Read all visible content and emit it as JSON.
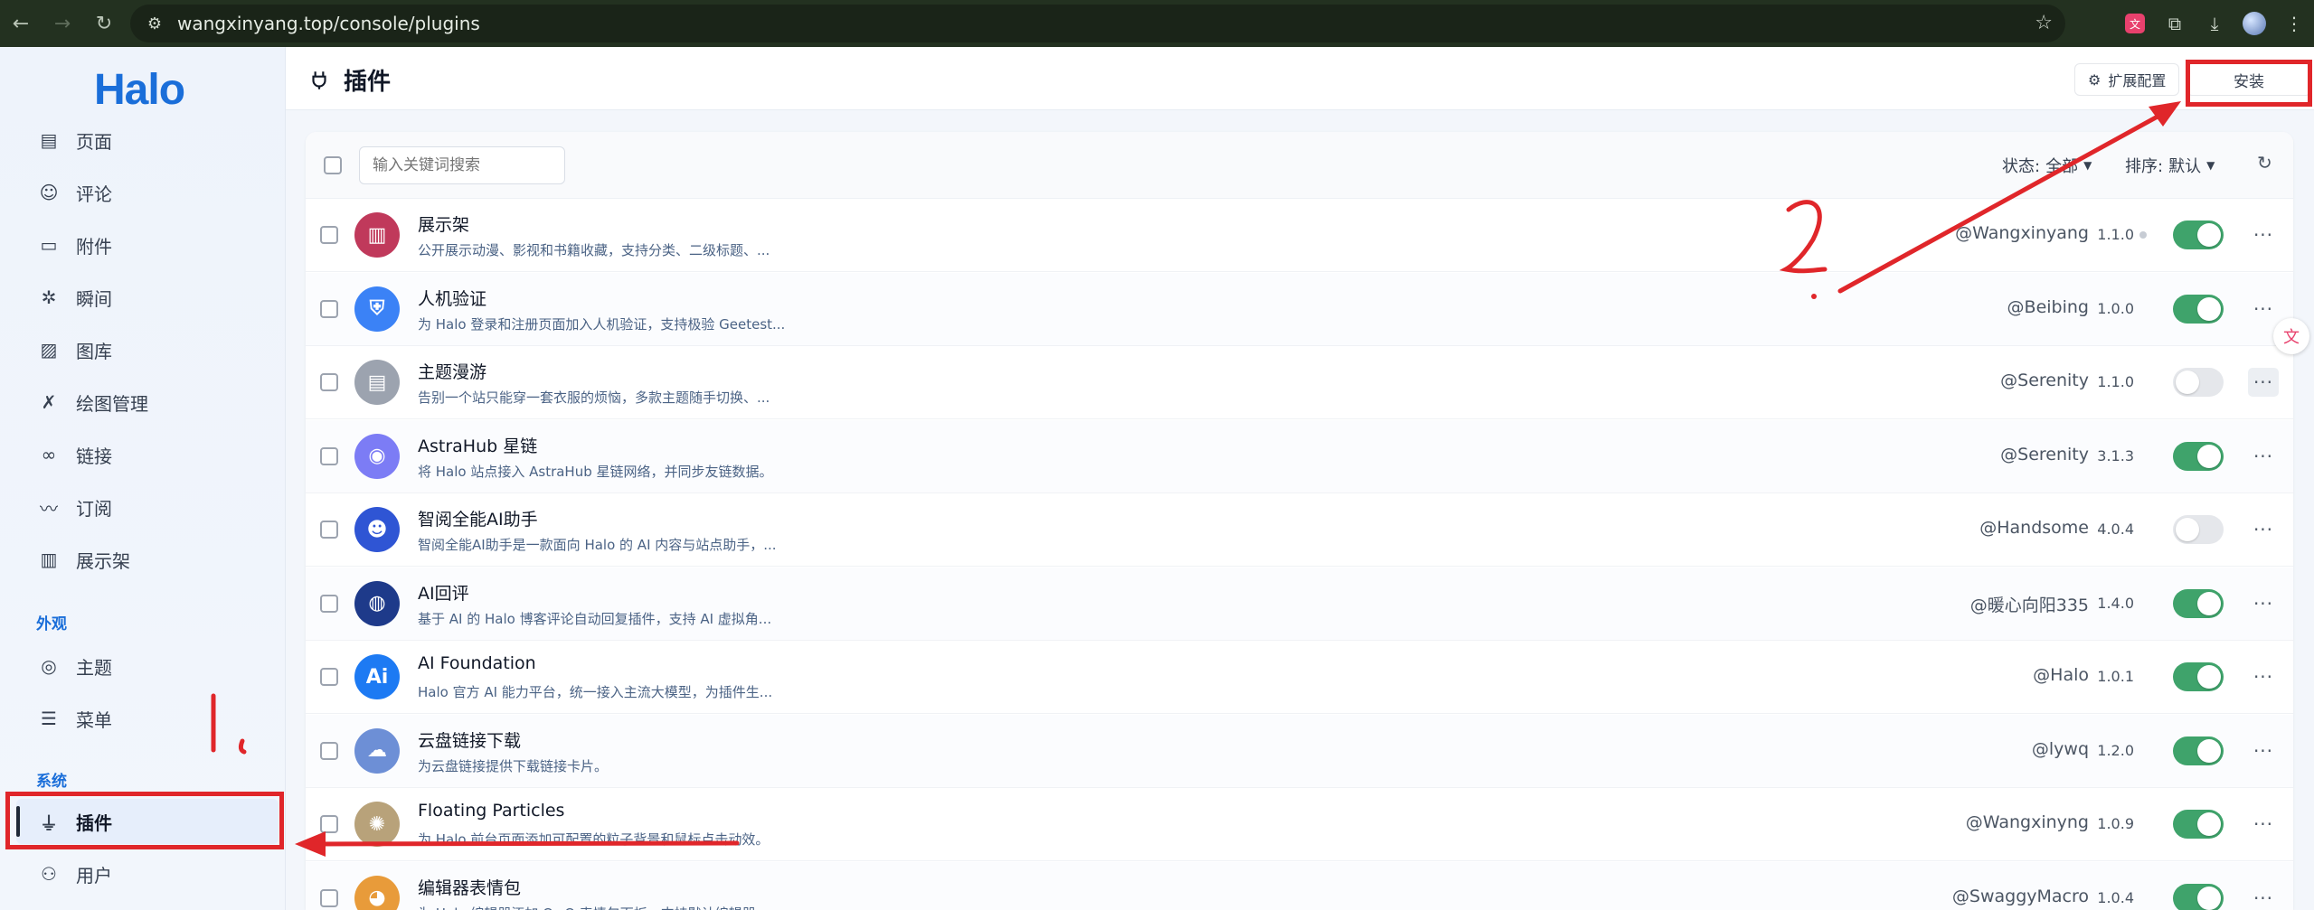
{
  "browser": {
    "url": "wangxinyang.top/console/plugins"
  },
  "sidebar": {
    "logo": "Halo",
    "items": [
      {
        "key": "page",
        "label": "页面",
        "icon": "document-icon"
      },
      {
        "key": "comment",
        "label": "评论",
        "icon": "comment-icon"
      },
      {
        "key": "attachment",
        "label": "附件",
        "icon": "folder-icon"
      },
      {
        "key": "moment",
        "label": "瞬间",
        "icon": "aperture-icon"
      },
      {
        "key": "gallery",
        "label": "图库",
        "icon": "image-icon"
      },
      {
        "key": "drawing",
        "label": "绘图管理",
        "icon": "tools-icon"
      },
      {
        "key": "links",
        "label": "链接",
        "icon": "link-icon"
      },
      {
        "key": "subscribe",
        "label": "订阅",
        "icon": "rss-icon"
      },
      {
        "key": "shelf",
        "label": "展示架",
        "icon": "shelf-icon"
      }
    ],
    "group_appearance": "外观",
    "appearance_items": [
      {
        "key": "theme",
        "label": "主题",
        "icon": "palette-icon"
      },
      {
        "key": "menu",
        "label": "菜单",
        "icon": "menu-settings-icon"
      }
    ],
    "group_system": "系统",
    "system_items": [
      {
        "key": "plugins",
        "label": "插件",
        "icon": "plug-icon",
        "active": true
      },
      {
        "key": "users",
        "label": "用户",
        "icon": "user-icon"
      }
    ]
  },
  "header": {
    "title": "插件",
    "ext_config_label": "扩展配置",
    "install_label": "安装"
  },
  "toolbar": {
    "search_placeholder": "输入关键词搜索",
    "status_label": "状态:",
    "status_value": "全部",
    "sort_label": "排序:",
    "sort_value": "默认"
  },
  "plugins": [
    {
      "name": "展示架",
      "desc": "公开展示动漫、影视和书籍收藏，支持分类、二级标题、...",
      "author": "@Wangxinyang",
      "version": "1.1.0",
      "enabled": true,
      "logo_color": "#c0395b",
      "logo_text": "▥",
      "dot": true
    },
    {
      "name": "人机验证",
      "desc": "为 Halo 登录和注册页面加入人机验证，支持极验 Geetest...",
      "author": "@Beibing",
      "version": "1.0.0",
      "enabled": true,
      "logo_color": "#3b82f6",
      "logo_text": "⛨"
    },
    {
      "name": "主题漫游",
      "desc": "告别一个站只能穿一套衣服的烦恼，多款主题随手切换、...",
      "author": "@Serenity",
      "version": "1.1.0",
      "enabled": false,
      "logo_color": "#9ca3af",
      "logo_text": "▤",
      "more_hover": true
    },
    {
      "name": "AstraHub 星链",
      "desc": "将 Halo 站点接入 AstraHub 星链网络，并同步友链数据。",
      "author": "@Serenity",
      "version": "3.1.3",
      "enabled": true,
      "logo_color": "#7c7cf5",
      "logo_text": "◉"
    },
    {
      "name": "智阅全能AI助手",
      "desc": "智阅全能AI助手是一款面向 Halo 的 AI 内容与站点助手，...",
      "author": "@Handsome",
      "version": "4.0.4",
      "enabled": false,
      "logo_color": "#2f55d4",
      "logo_text": "☻"
    },
    {
      "name": "AI回评",
      "desc": "基于 AI 的 Halo 博客评论自动回复插件，支持 AI 虚拟角...",
      "author": "@暖心向阳335",
      "version": "1.4.0",
      "enabled": true,
      "logo_color": "#1e3a8a",
      "logo_text": "◍"
    },
    {
      "name": "AI Foundation",
      "desc": "Halo 官方 AI 能力平台，统一接入主流大模型，为插件生...",
      "author": "@Halo",
      "version": "1.0.1",
      "enabled": true,
      "logo_color": "#1d7af3",
      "logo_text": "Ai"
    },
    {
      "name": "云盘链接下载",
      "desc": "为云盘链接提供下载链接卡片。",
      "author": "@lywq",
      "version": "1.2.0",
      "enabled": true,
      "logo_color": "#6d8fd6",
      "logo_text": "☁"
    },
    {
      "name": "Floating Particles",
      "desc": "为 Halo 前台页面添加可配置的粒子背景和鼠标点击动效。",
      "author": "@Wangxinyng",
      "version": "1.0.9",
      "enabled": true,
      "logo_color": "#b8a27a",
      "logo_text": "✺"
    },
    {
      "name": "编辑器表情包",
      "desc": "为 Halo 编辑器添加 QwQ 表情包面板，支持默认编辑器...",
      "author": "@SwaggyMacro",
      "version": "1.0.4",
      "enabled": true,
      "logo_color": "#e89b3a",
      "logo_text": "◕"
    }
  ],
  "annotations": {
    "label_one": "1.",
    "label_two": "2.",
    "color": "#e0262a"
  }
}
